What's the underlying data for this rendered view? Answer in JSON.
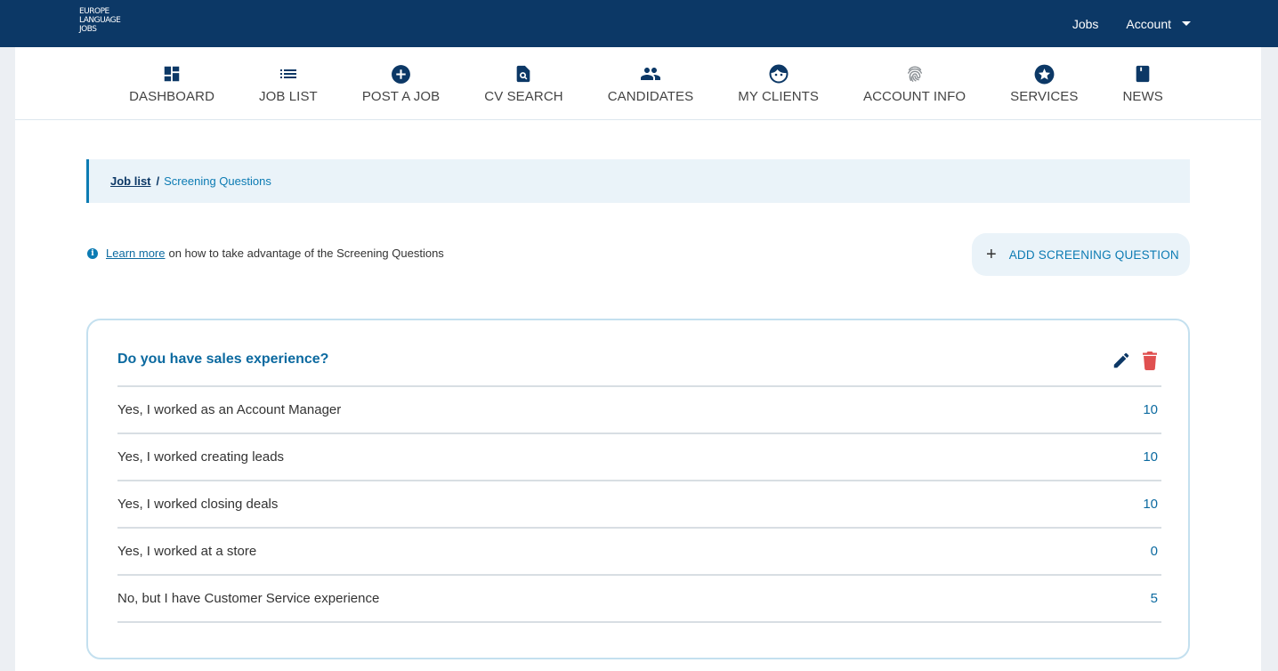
{
  "logo": {
    "lines": [
      "EUROPE",
      "LANGUAGE",
      "JOBS"
    ]
  },
  "topnav": {
    "jobs": "Jobs",
    "account": "Account"
  },
  "nav": [
    {
      "label": "DASHBOARD",
      "icon": "dashboard-icon"
    },
    {
      "label": "JOB LIST",
      "icon": "list-icon"
    },
    {
      "label": "POST A JOB",
      "icon": "add-circle-icon"
    },
    {
      "label": "CV SEARCH",
      "icon": "document-search-icon"
    },
    {
      "label": "CANDIDATES",
      "icon": "people-icon"
    },
    {
      "label": "MY CLIENTS",
      "icon": "face-icon"
    },
    {
      "label": "ACCOUNT INFO",
      "icon": "fingerprint-icon"
    },
    {
      "label": "SERVICES",
      "icon": "star-circle-icon"
    },
    {
      "label": "NEWS",
      "icon": "book-icon"
    }
  ],
  "breadcrumb": {
    "parent": "Job list",
    "separator": "/",
    "current": "Screening Questions"
  },
  "info": {
    "icon": "i",
    "link": "Learn more",
    "text": "on how to take advantage of the Screening Questions"
  },
  "add_button": {
    "plus": "+",
    "label": "ADD SCREENING QUESTION"
  },
  "question": {
    "title": "Do you have sales experience?",
    "answers": [
      {
        "text": "Yes, I worked as an Account Manager",
        "score": "10"
      },
      {
        "text": "Yes, I worked creating leads",
        "score": "10"
      },
      {
        "text": "Yes, I worked closing deals",
        "score": "10"
      },
      {
        "text": "Yes, I worked at a store",
        "score": "0"
      },
      {
        "text": "No, but I have Customer Service experience",
        "score": "5"
      }
    ]
  },
  "colors": {
    "navy": "#0c3866",
    "accent": "#0c7bb3",
    "delete": "#e05050"
  }
}
